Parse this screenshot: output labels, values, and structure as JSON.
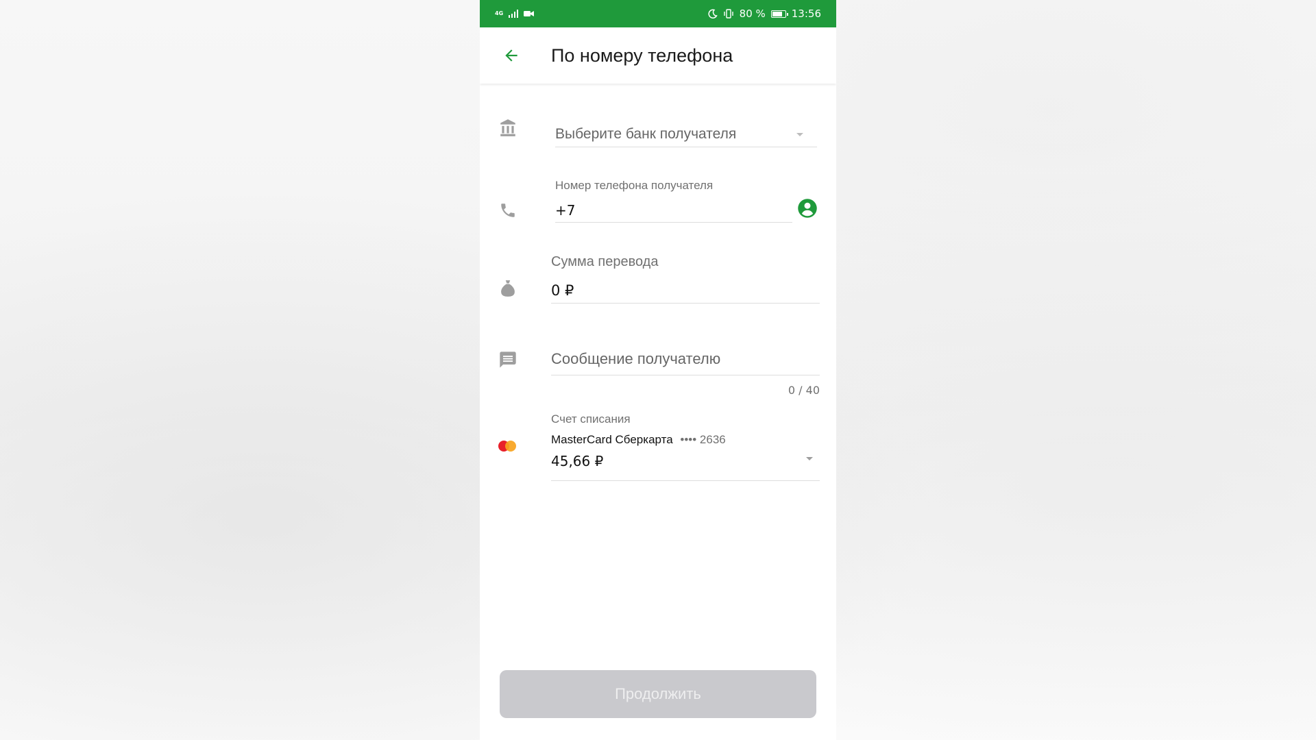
{
  "status_bar": {
    "network": "4G",
    "battery_percent": "80 %",
    "battery_level": 0.8,
    "time": "13:56"
  },
  "header": {
    "title": "По номеру телефона"
  },
  "form": {
    "bank": {
      "placeholder": "Выберите банк получателя"
    },
    "phone": {
      "label": "Номер телефона получателя",
      "value": "+7"
    },
    "amount": {
      "label": "Сумма перевода",
      "value": "0 ₽"
    },
    "message": {
      "placeholder": "Сообщение получателю",
      "counter": "0 / 40"
    },
    "account": {
      "label": "Счет списания",
      "card_name": "MasterCard Сберкарта",
      "card_mask": "•••• 2636",
      "balance": "45,66 ₽"
    }
  },
  "footer": {
    "continue_label": "Продолжить"
  },
  "colors": {
    "brand_green": "#1f9a3b",
    "button_disabled": "#c9c9cd",
    "icon_gray": "#9e9e9e"
  }
}
